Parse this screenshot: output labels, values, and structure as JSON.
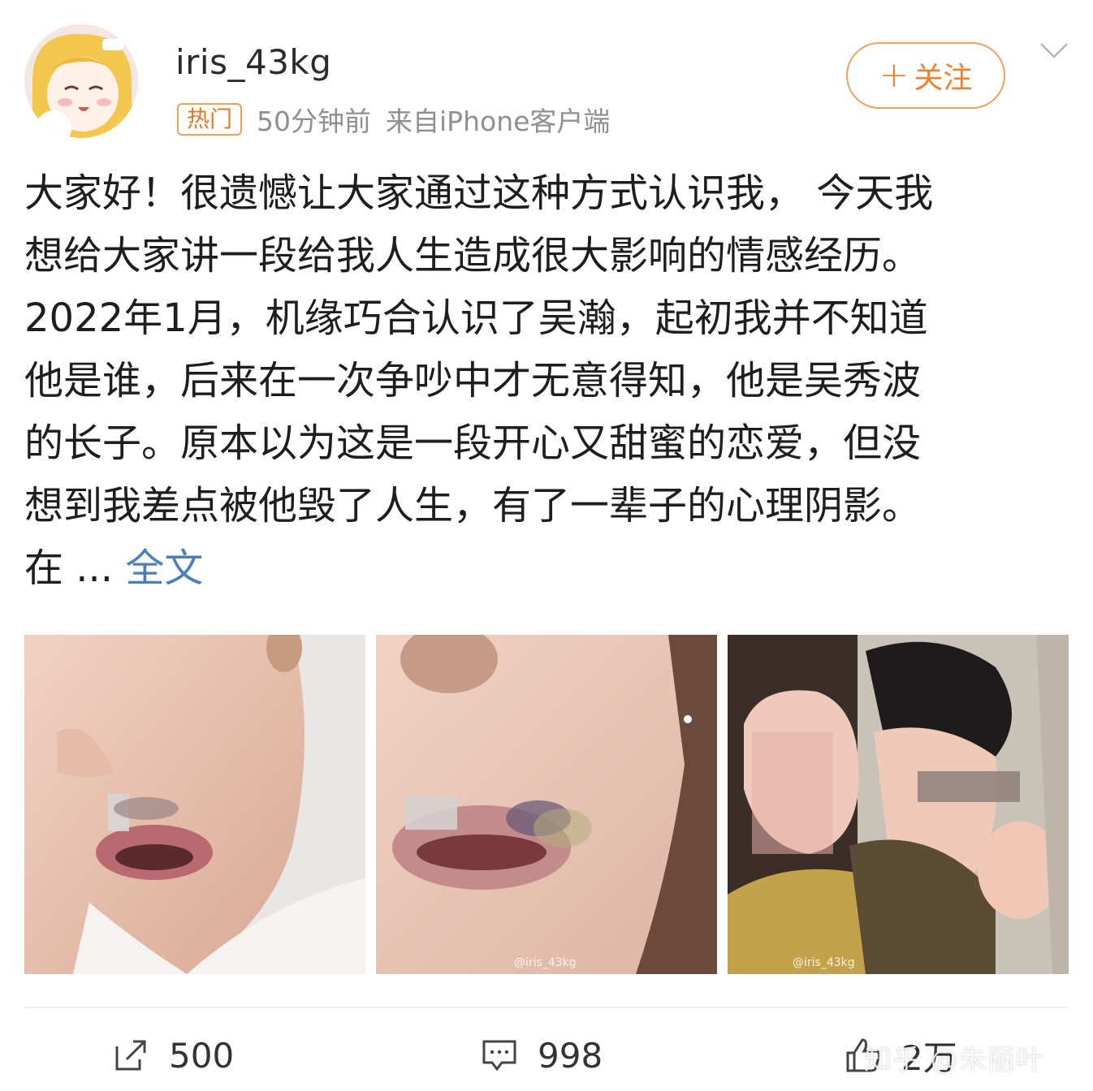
{
  "user": {
    "name": "iris_43kg",
    "badge": "热门",
    "time": "50分钟前",
    "source": "来自iPhone客户端"
  },
  "follow": {
    "icon": "plus-icon",
    "label": "关注"
  },
  "post": {
    "lines": [
      "大家好！很遗憾让大家通过这种方式认识我， 今天我",
      "想给大家讲一段给我人生造成很大影响的情感经历。",
      "2022年1月，机缘巧合认识了吴瀚，起初我并不知道",
      "他是谁，后来在一次争吵中才无意得知，他是吴秀波",
      "的长子。原本以为这是一段开心又甜蜜的恋爱，但没",
      "想到我差点被他毁了人生，有了一辈子的心理阴影。"
    ],
    "last_line": "在 ...",
    "more": "全文"
  },
  "photos": {
    "watermark2": "@iris_43kg",
    "watermark3": "@iris_43kg"
  },
  "actions": {
    "repost_count": "500",
    "comment_count": "998",
    "like_count": "2万"
  },
  "watermark": "知乎 @朱丽叶",
  "colors": {
    "accent_orange": "#ec8131",
    "link_blue": "#4b7fb7",
    "meta_gray": "#8f8f8f"
  }
}
